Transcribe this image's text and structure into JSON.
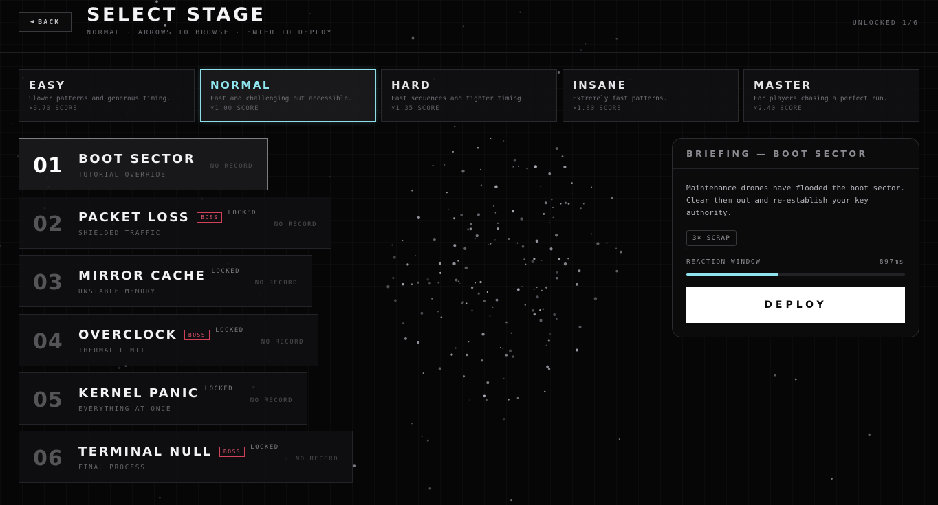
{
  "header": {
    "back_label": "BACK",
    "title": "SELECT STAGE",
    "subtitle": "NORMAL · ARROWS TO BROWSE · ENTER TO DEPLOY",
    "unlocked": "UNLOCKED 1/6"
  },
  "difficulties": [
    {
      "name": "EASY",
      "desc": "Slower patterns and generous timing.",
      "mult": "×0.70 SCORE"
    },
    {
      "name": "NORMAL",
      "desc": "Fast and challenging but accessible.",
      "mult": "×1.00 SCORE"
    },
    {
      "name": "HARD",
      "desc": "Fast sequences and tighter timing.",
      "mult": "×1.35 SCORE"
    },
    {
      "name": "INSANE",
      "desc": "Extremely fast patterns.",
      "mult": "×1.80 SCORE"
    },
    {
      "name": "MASTER",
      "desc": "For players chasing a perfect run.",
      "mult": "×2.40 SCORE"
    }
  ],
  "selected_difficulty": 1,
  "stages": [
    {
      "num": "01",
      "name": "BOOT SECTOR",
      "sub": "TUTORIAL OVERRIDE",
      "boss": "",
      "locked": "",
      "record": "NO RECORD"
    },
    {
      "num": "02",
      "name": "PACKET LOSS",
      "sub": "SHIELDED TRAFFIC",
      "boss": "BOSS",
      "locked": "LOCKED",
      "record": "NO RECORD"
    },
    {
      "num": "03",
      "name": "MIRROR CACHE",
      "sub": "UNSTABLE MEMORY",
      "boss": "",
      "locked": "LOCKED",
      "record": "NO RECORD"
    },
    {
      "num": "04",
      "name": "OVERCLOCK",
      "sub": "THERMAL LIMIT",
      "boss": "BOSS",
      "locked": "LOCKED",
      "record": "NO RECORD"
    },
    {
      "num": "05",
      "name": "KERNEL PANIC",
      "sub": "EVERYTHING AT ONCE",
      "boss": "",
      "locked": "LOCKED",
      "record": "NO RECORD"
    },
    {
      "num": "06",
      "name": "TERMINAL NULL",
      "sub": "FINAL PROCESS",
      "boss": "BOSS",
      "locked": "LOCKED",
      "record": "NO RECORD"
    }
  ],
  "selected_stage": 0,
  "briefing": {
    "title": "BRIEFING — BOOT SECTOR",
    "desc": "Maintenance drones have flooded the boot sector. Clear them out and re-establish your key authority.",
    "reward": "3× SCRAP",
    "reaction_label": "REACTION WINDOW",
    "reaction_value": "897ms",
    "reaction_fraction": 0.42,
    "deploy_label": "DEPLOY"
  },
  "colors": {
    "accent": "#8fe6ee",
    "boss": "#e0566f",
    "background": "#060607"
  }
}
